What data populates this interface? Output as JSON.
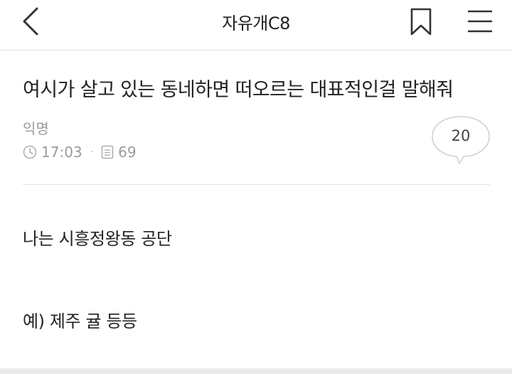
{
  "header": {
    "title": "자유개C8",
    "back_icon": "chevron-left-icon",
    "bookmark_icon": "bookmark-icon",
    "menu_icon": "hamburger-menu-icon"
  },
  "post": {
    "title": "여시가 살고 있는 동네하면 떠오르는 대표적인걸 말해줘",
    "author": "익명",
    "time": "17:03",
    "separator": "·",
    "views": "69",
    "comment_count": "20",
    "body": [
      "나는 시흥정왕동 공단",
      "예) 제주 귤 등등"
    ]
  },
  "colors": {
    "text": "#222222",
    "meta": "#9a9a9a",
    "divider": "#e2e2e2",
    "bubble_border": "#d0d0d0"
  }
}
